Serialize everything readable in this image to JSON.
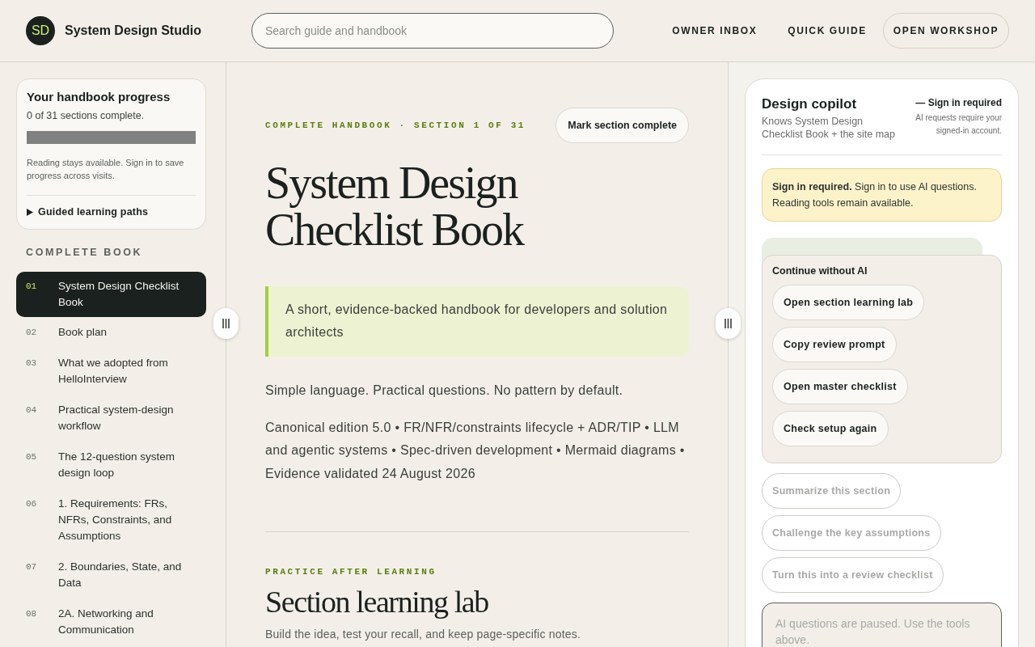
{
  "header": {
    "logo": "SD",
    "brand": "System Design Studio",
    "search": {
      "placeholder": "Search guide and handbook"
    },
    "nav": [
      {
        "label": "OWNER INBOX",
        "kind": "link"
      },
      {
        "label": "QUICK GUIDE",
        "kind": "link"
      },
      {
        "label": "OPEN WORKSHOP",
        "kind": "button"
      }
    ]
  },
  "sidebar": {
    "progress": {
      "title": "Your handbook progress",
      "summary": "0 of 31 sections complete.",
      "level": 0,
      "note": "Reading stays available. Sign in to save progress across visits.",
      "paths_toggle": {
        "label": "Guided learning paths",
        "expanded": false
      }
    },
    "heading": "COMPLETE BOOK",
    "items": [
      {
        "number": "01",
        "title": "System Design Checklist Book",
        "selected": true
      },
      {
        "number": "02",
        "title": "Book plan",
        "selected": false
      },
      {
        "number": "03",
        "title": "What we adopted from HelloInterview",
        "selected": false
      },
      {
        "number": "04",
        "title": "Practical system-design workflow",
        "selected": false
      },
      {
        "number": "05",
        "title": "The 12-question system design loop",
        "selected": false
      },
      {
        "number": "06",
        "title": "1. Requirements: FRs, NFRs, Constraints, and Assumptions",
        "selected": false
      },
      {
        "number": "07",
        "title": "2. Boundaries, State, and Data",
        "selected": false
      },
      {
        "number": "08",
        "title": "2A. Networking and Communication",
        "selected": false
      }
    ]
  },
  "main": {
    "eyebrow": "COMPLETE HANDBOOK · SECTION 1 OF 31",
    "complete_button": "Mark section complete",
    "title": "System Design Checklist Book",
    "summary": "A short, evidence-backed handbook for developers and solution architects",
    "paragraphs": [
      "Simple language. Practical questions. No pattern by default.",
      "Canonical edition 5.0 • FR/NFR/constraints lifecycle + ADR/TIP • LLM and agentic systems • Spec-driven development • Mermaid diagrams • Evidence validated 24 August 2026"
    ],
    "lab": {
      "eyebrow": "PRACTICE AFTER LEARNING",
      "title": "Section learning lab",
      "description": "Build the idea, test your recall, and keep page-specific notes."
    }
  },
  "copilot": {
    "title": "Design copilot",
    "description": "Knows System Design Checklist Book + the site map",
    "status": "— Sign in required",
    "status_note": "AI requests require your signed-in account.",
    "notice": "**Sign in required.** Sign in to use AI questions. Reading tools remain available.",
    "fallback": {
      "title": "Continue without AI",
      "actions": [
        "Open section learning lab",
        "Copy review prompt",
        "Open master checklist",
        "Check setup again"
      ]
    },
    "suggestions": [
      {
        "label": "Summarize this section",
        "disabled": true
      },
      {
        "label": "Challenge the key assumptions",
        "disabled": true
      },
      {
        "label": "Turn this into a review checklist",
        "disabled": true
      }
    ],
    "input": {
      "placeholder": "AI questions are paused. Use the tools above."
    }
  }
}
